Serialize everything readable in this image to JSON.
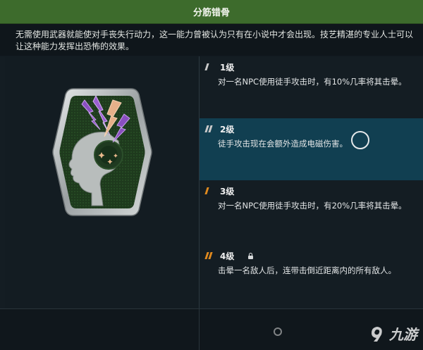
{
  "header": {
    "title": "分筋错骨"
  },
  "description": "无需使用武器就能使对手丧失行动力，这一能力曾被认为只有在小说中才会出现。技艺精湛的专业人士可以让这种能力发挥出恐怖的效果。",
  "badge": {
    "icon": "brain-lightning-badge-icon"
  },
  "ranks": [
    {
      "label": "1级",
      "desc": "对一名NPC使用徒手攻击时，有10%几率将其击晕。",
      "state": "unlocked",
      "bars": 1,
      "bar_color": "#c9c9c9"
    },
    {
      "label": "2级",
      "desc": "徒手攻击现在会额外造成电磁伤害。",
      "state": "selected",
      "bars": 2,
      "bar_color": "#c9c9c9"
    },
    {
      "label": "3级",
      "desc": "对一名NPC使用徒手攻击时，有20%几率将其击晕。",
      "state": "unlocked",
      "bars": 1,
      "bar_color": "#e08a1e"
    },
    {
      "label": "4级",
      "desc": "击晕一名敌人后，连带击倒近距离内的所有敌人。",
      "state": "locked",
      "bars": 2,
      "bar_color": "#e08a1e"
    }
  ],
  "watermark": "九游",
  "colors": {
    "title_bar": "#3d6b2c",
    "active_row": "#113f51",
    "rank_accent": "#e08a1e",
    "badge_purple": "#8a4fc0"
  }
}
